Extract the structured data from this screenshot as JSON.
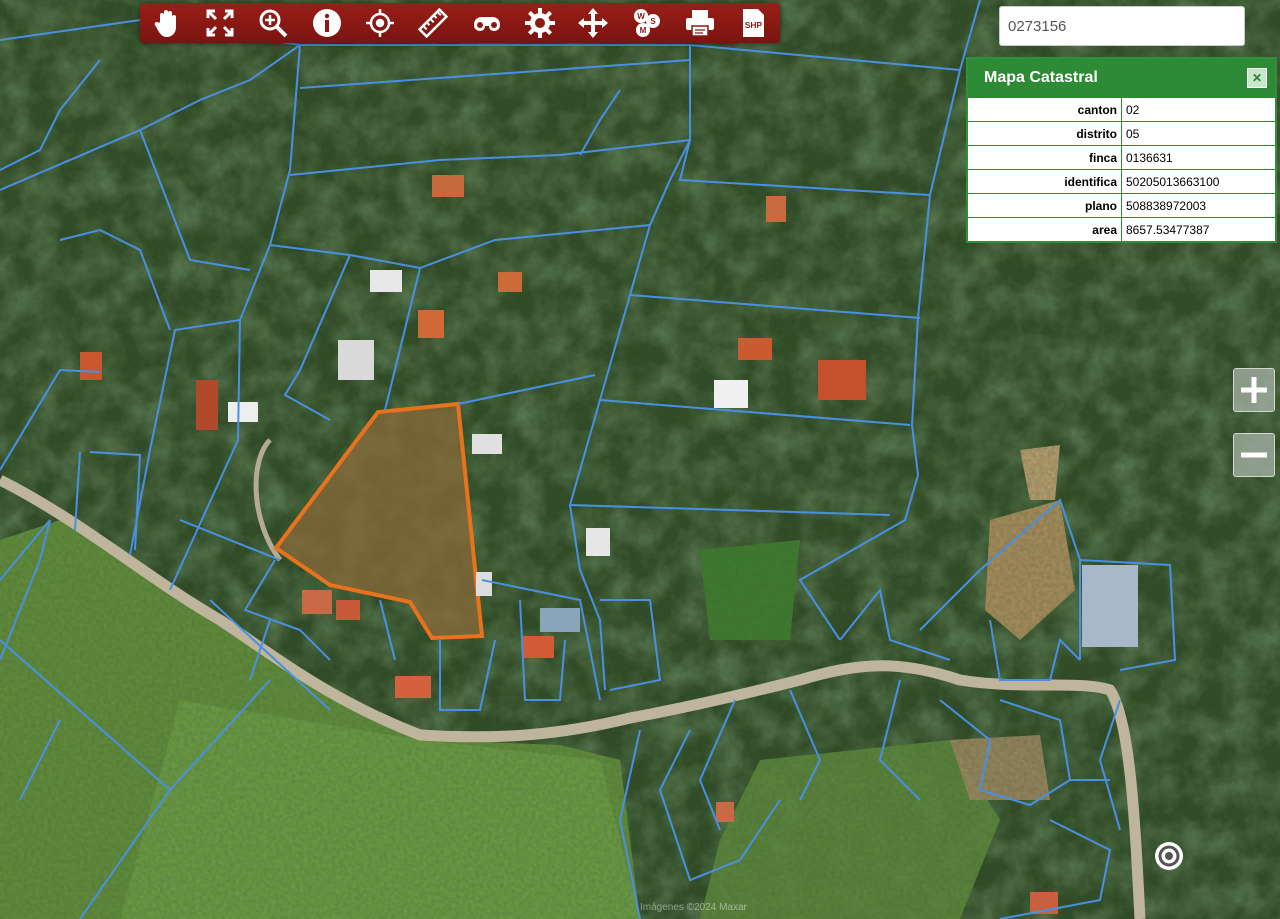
{
  "toolbar": {
    "tools": [
      {
        "name": "pan-tool",
        "icon": "hand-icon"
      },
      {
        "name": "full-extent-tool",
        "icon": "expand-icon"
      },
      {
        "name": "zoom-in-tool",
        "icon": "magnifier-plus-icon"
      },
      {
        "name": "identify-tool",
        "icon": "info-icon"
      },
      {
        "name": "locate-tool",
        "icon": "crosshair-icon"
      },
      {
        "name": "measure-tool",
        "icon": "ruler-icon"
      },
      {
        "name": "street-view-tool",
        "icon": "binoculars-icon"
      },
      {
        "name": "settings-tool",
        "icon": "gear-icon"
      },
      {
        "name": "move-tool",
        "icon": "move-arrows-icon"
      },
      {
        "name": "wms-tool",
        "icon": "wms-icon",
        "label": "WMS"
      },
      {
        "name": "print-tool",
        "icon": "printer-icon"
      },
      {
        "name": "shp-tool",
        "icon": "shp-file-icon",
        "label": "SHP"
      }
    ],
    "colors": {
      "background": "#8b1a14",
      "icon": "#ffffff"
    }
  },
  "search": {
    "value": "0273156",
    "placeholder": ""
  },
  "panel": {
    "title": "Mapa Catastral",
    "close_symbol": "✕",
    "rows": [
      {
        "key": "canton",
        "value": "02"
      },
      {
        "key": "distrito",
        "value": "05"
      },
      {
        "key": "finca",
        "value": "0136631"
      },
      {
        "key": "identifica",
        "value": "50205013663100"
      },
      {
        "key": "plano",
        "value": "508838972003"
      },
      {
        "key": "area",
        "value": "8657.53477387"
      }
    ],
    "colors": {
      "header": "#2e8b35",
      "border": "#2e8b35"
    }
  },
  "zoom": {
    "in_symbol": "+",
    "out_symbol": "−"
  },
  "attribution": "Imágenes ©2024 Maxar",
  "map": {
    "parcel_line_color": "#4a90e2",
    "selected_parcel_color": "#e8731c"
  }
}
